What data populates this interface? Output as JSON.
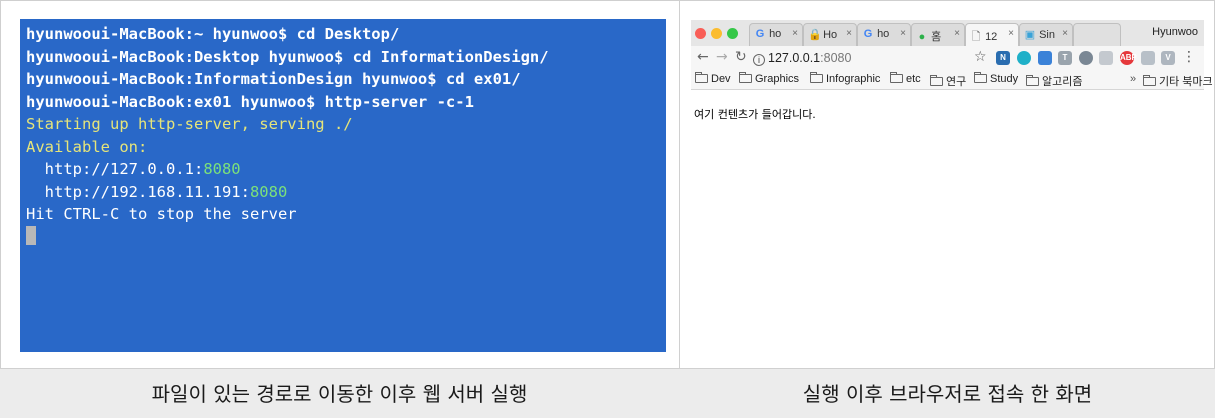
{
  "terminal": {
    "lines": [
      "hyunwooui-MacBook:~ hyunwoo$ cd Desktop/",
      "hyunwooui-MacBook:Desktop hyunwoo$ cd InformationDesign/",
      "hyunwooui-MacBook:InformationDesign hyunwoo$ cd ex01/",
      "hyunwooui-MacBook:ex01 hyunwoo$ http-server -c-1",
      "Starting up http-server, serving ./",
      "Available on:"
    ],
    "url1_host": "  http://127.0.0.1:",
    "url1_port": "8080",
    "url2_host": "  http://192.168.11.191:",
    "url2_port": "8080",
    "hint": "Hit CTRL-C to stop the server",
    "colors": {
      "background": "#2968c8",
      "yellow": "#e6e57a",
      "green": "#7be07b"
    }
  },
  "browser": {
    "tabs": [
      {
        "icon": "G",
        "label": "ho",
        "icon_name": "google-icon"
      },
      {
        "icon": "🔒",
        "label": "Ho",
        "icon_name": "lock-icon"
      },
      {
        "icon": "G",
        "label": "ho",
        "icon_name": "google-icon"
      },
      {
        "icon": "●",
        "label": "홈",
        "icon_name": "green-circle-icon"
      },
      {
        "icon": "🗋",
        "label": "12",
        "icon_name": "page-icon",
        "active": true
      },
      {
        "icon": "▣",
        "label": "Sin",
        "icon_name": "image-icon"
      }
    ],
    "close_glyph": "×",
    "profile": "Hyunwoo",
    "url_host": "127.0.0.1",
    "url_port": ":8080",
    "bookmarks": [
      "Dev",
      "Graphics",
      "Infographic",
      "etc",
      "연구",
      "Study",
      "알고리즘"
    ],
    "more_label": "»",
    "other_bookmarks": "기타 북마크",
    "content_text": "여기 컨텐츠가 들어갑니다."
  },
  "captions": {
    "left": "파일이 있는 경로로 이동한 이후 웹 서버 실행",
    "right": "실행 이후 브라우저로 접속 한 화면"
  }
}
